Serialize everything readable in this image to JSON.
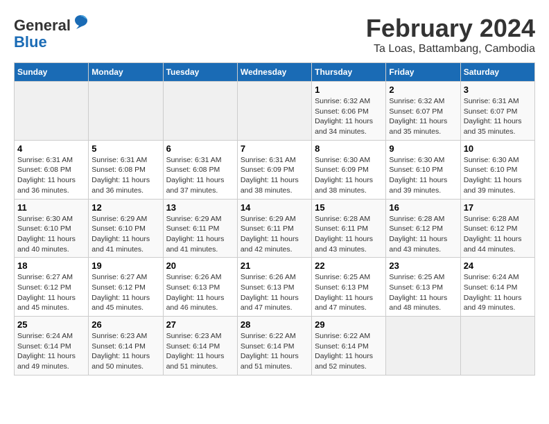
{
  "header": {
    "logo_general": "General",
    "logo_blue": "Blue",
    "month_year": "February 2024",
    "location": "Ta Loas, Battambang, Cambodia"
  },
  "days_of_week": [
    "Sunday",
    "Monday",
    "Tuesday",
    "Wednesday",
    "Thursday",
    "Friday",
    "Saturday"
  ],
  "weeks": [
    [
      {
        "day": "",
        "info": ""
      },
      {
        "day": "",
        "info": ""
      },
      {
        "day": "",
        "info": ""
      },
      {
        "day": "",
        "info": ""
      },
      {
        "day": "1",
        "info": "Sunrise: 6:32 AM\nSunset: 6:06 PM\nDaylight: 11 hours\nand 34 minutes."
      },
      {
        "day": "2",
        "info": "Sunrise: 6:32 AM\nSunset: 6:07 PM\nDaylight: 11 hours\nand 35 minutes."
      },
      {
        "day": "3",
        "info": "Sunrise: 6:31 AM\nSunset: 6:07 PM\nDaylight: 11 hours\nand 35 minutes."
      }
    ],
    [
      {
        "day": "4",
        "info": "Sunrise: 6:31 AM\nSunset: 6:08 PM\nDaylight: 11 hours\nand 36 minutes."
      },
      {
        "day": "5",
        "info": "Sunrise: 6:31 AM\nSunset: 6:08 PM\nDaylight: 11 hours\nand 36 minutes."
      },
      {
        "day": "6",
        "info": "Sunrise: 6:31 AM\nSunset: 6:08 PM\nDaylight: 11 hours\nand 37 minutes."
      },
      {
        "day": "7",
        "info": "Sunrise: 6:31 AM\nSunset: 6:09 PM\nDaylight: 11 hours\nand 38 minutes."
      },
      {
        "day": "8",
        "info": "Sunrise: 6:30 AM\nSunset: 6:09 PM\nDaylight: 11 hours\nand 38 minutes."
      },
      {
        "day": "9",
        "info": "Sunrise: 6:30 AM\nSunset: 6:10 PM\nDaylight: 11 hours\nand 39 minutes."
      },
      {
        "day": "10",
        "info": "Sunrise: 6:30 AM\nSunset: 6:10 PM\nDaylight: 11 hours\nand 39 minutes."
      }
    ],
    [
      {
        "day": "11",
        "info": "Sunrise: 6:30 AM\nSunset: 6:10 PM\nDaylight: 11 hours\nand 40 minutes."
      },
      {
        "day": "12",
        "info": "Sunrise: 6:29 AM\nSunset: 6:10 PM\nDaylight: 11 hours\nand 41 minutes."
      },
      {
        "day": "13",
        "info": "Sunrise: 6:29 AM\nSunset: 6:11 PM\nDaylight: 11 hours\nand 41 minutes."
      },
      {
        "day": "14",
        "info": "Sunrise: 6:29 AM\nSunset: 6:11 PM\nDaylight: 11 hours\nand 42 minutes."
      },
      {
        "day": "15",
        "info": "Sunrise: 6:28 AM\nSunset: 6:11 PM\nDaylight: 11 hours\nand 43 minutes."
      },
      {
        "day": "16",
        "info": "Sunrise: 6:28 AM\nSunset: 6:12 PM\nDaylight: 11 hours\nand 43 minutes."
      },
      {
        "day": "17",
        "info": "Sunrise: 6:28 AM\nSunset: 6:12 PM\nDaylight: 11 hours\nand 44 minutes."
      }
    ],
    [
      {
        "day": "18",
        "info": "Sunrise: 6:27 AM\nSunset: 6:12 PM\nDaylight: 11 hours\nand 45 minutes."
      },
      {
        "day": "19",
        "info": "Sunrise: 6:27 AM\nSunset: 6:12 PM\nDaylight: 11 hours\nand 45 minutes."
      },
      {
        "day": "20",
        "info": "Sunrise: 6:26 AM\nSunset: 6:13 PM\nDaylight: 11 hours\nand 46 minutes."
      },
      {
        "day": "21",
        "info": "Sunrise: 6:26 AM\nSunset: 6:13 PM\nDaylight: 11 hours\nand 47 minutes."
      },
      {
        "day": "22",
        "info": "Sunrise: 6:25 AM\nSunset: 6:13 PM\nDaylight: 11 hours\nand 47 minutes."
      },
      {
        "day": "23",
        "info": "Sunrise: 6:25 AM\nSunset: 6:13 PM\nDaylight: 11 hours\nand 48 minutes."
      },
      {
        "day": "24",
        "info": "Sunrise: 6:24 AM\nSunset: 6:14 PM\nDaylight: 11 hours\nand 49 minutes."
      }
    ],
    [
      {
        "day": "25",
        "info": "Sunrise: 6:24 AM\nSunset: 6:14 PM\nDaylight: 11 hours\nand 49 minutes."
      },
      {
        "day": "26",
        "info": "Sunrise: 6:23 AM\nSunset: 6:14 PM\nDaylight: 11 hours\nand 50 minutes."
      },
      {
        "day": "27",
        "info": "Sunrise: 6:23 AM\nSunset: 6:14 PM\nDaylight: 11 hours\nand 51 minutes."
      },
      {
        "day": "28",
        "info": "Sunrise: 6:22 AM\nSunset: 6:14 PM\nDaylight: 11 hours\nand 51 minutes."
      },
      {
        "day": "29",
        "info": "Sunrise: 6:22 AM\nSunset: 6:14 PM\nDaylight: 11 hours\nand 52 minutes."
      },
      {
        "day": "",
        "info": ""
      },
      {
        "day": "",
        "info": ""
      }
    ]
  ]
}
